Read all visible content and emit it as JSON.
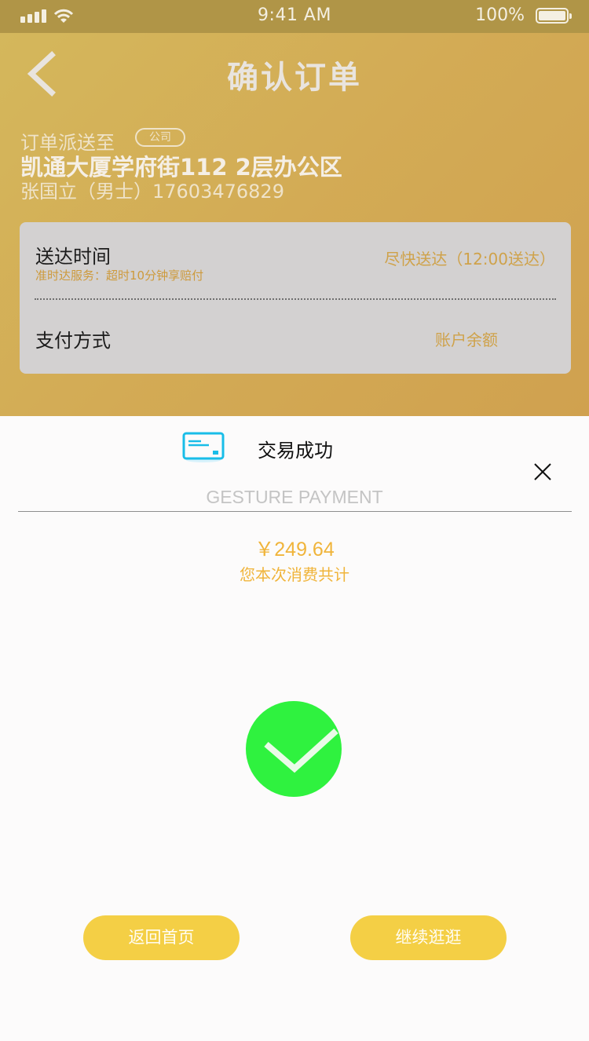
{
  "status_bar": {
    "time": "9:41 AM",
    "battery": "100%"
  },
  "header": {
    "title": "确认订单",
    "back_icon": "chevron-left-icon"
  },
  "address": {
    "label": "订单派送至",
    "tag": "公司",
    "main": "凯通大厦学府街112 2层办公区",
    "contact": "张国立（男士）17603476829"
  },
  "delivery": {
    "label": "送达时间",
    "sub": "准时达服务：超时10分钟享赔付",
    "value": "尽快送达（12:00送达）"
  },
  "payment": {
    "label": "支付方式",
    "value": "账户余额"
  },
  "sheet": {
    "card_icon": "credit-card-icon",
    "success_text": "交易成功",
    "close_icon": "close-icon",
    "gesture_label": "GESTURE PAYMENT",
    "amount": "￥249.64",
    "amount_label": "您本次消费共计",
    "check_icon": "check-circle-icon"
  },
  "buttons": {
    "home": "返回首页",
    "continue": "继续逛逛"
  },
  "colors": {
    "accent": "#f4cf45",
    "success": "#2ff23f",
    "amount": "#f0b43a",
    "header": "#d3ab55"
  }
}
